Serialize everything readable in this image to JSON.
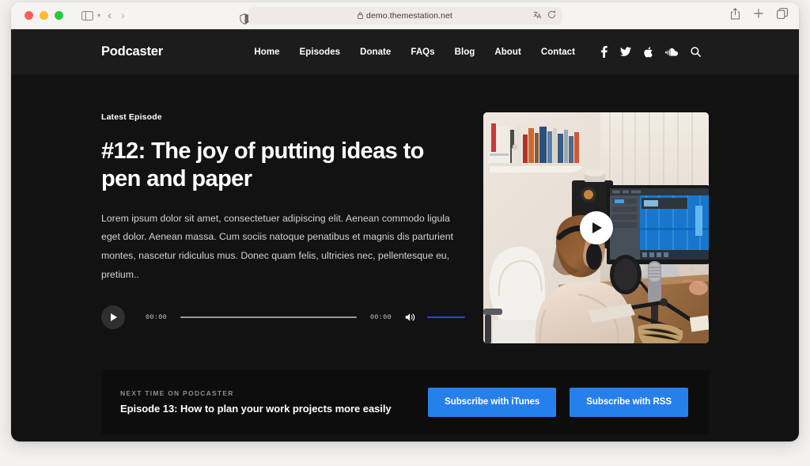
{
  "browser": {
    "url": "demo.themestation.net",
    "lock_icon": "lock-icon",
    "sidebar_icon": "sidebar-toggle-icon",
    "back_label": "‹",
    "forward_label": "›",
    "reader_icon": "reader-view-icon",
    "translate_icon": "translate-icon",
    "reload_icon": "reload-icon",
    "share_icon": "share-icon",
    "new_tab_icon": "plus-icon",
    "tabs_icon": "tab-overview-icon"
  },
  "site": {
    "brand": "Podcaster",
    "nav": [
      {
        "label": "Home"
      },
      {
        "label": "Episodes"
      },
      {
        "label": "Donate"
      },
      {
        "label": "FAQs"
      },
      {
        "label": "Blog"
      },
      {
        "label": "About"
      },
      {
        "label": "Contact"
      }
    ],
    "socials": [
      {
        "name": "facebook-icon"
      },
      {
        "name": "twitter-icon"
      },
      {
        "name": "apple-icon"
      },
      {
        "name": "soundcloud-icon"
      },
      {
        "name": "search-icon"
      }
    ]
  },
  "hero": {
    "eyebrow": "Latest Episode",
    "title": "#12: The joy of putting ideas to pen and paper",
    "body": "Lorem ipsum dolor sit amet, consectetuer adipiscing elit. Aenean commodo ligula eget dolor. Aenean massa. Cum sociis natoque penatibus et magnis dis parturient montes, nascetur ridiculus mus. Donec quam felis, ultricies nec, pellentesque eu, pretium..",
    "player": {
      "current_time": "00:00",
      "duration": "00:00",
      "play_icon": "play-icon",
      "volume_icon": "volume-icon",
      "progress_percent": 0,
      "volume_percent": 100
    },
    "video": {
      "play_icon": "play-icon",
      "alt": "Podcaster recording at desk with microphone and monitor"
    }
  },
  "next_banner": {
    "kicker": "NEXT TIME ON PODCASTER",
    "title": "Episode 13: How to plan your work projects more easily",
    "buttons": [
      {
        "label": "Subscribe with iTunes"
      },
      {
        "label": "Subscribe with RSS"
      }
    ]
  },
  "colors": {
    "accent_blue": "#2680eb",
    "volume_blue": "#2e3ff2",
    "page_bg": "#121212",
    "header_bg": "#1c1c1c",
    "banner_bg": "#0d0d0d"
  }
}
